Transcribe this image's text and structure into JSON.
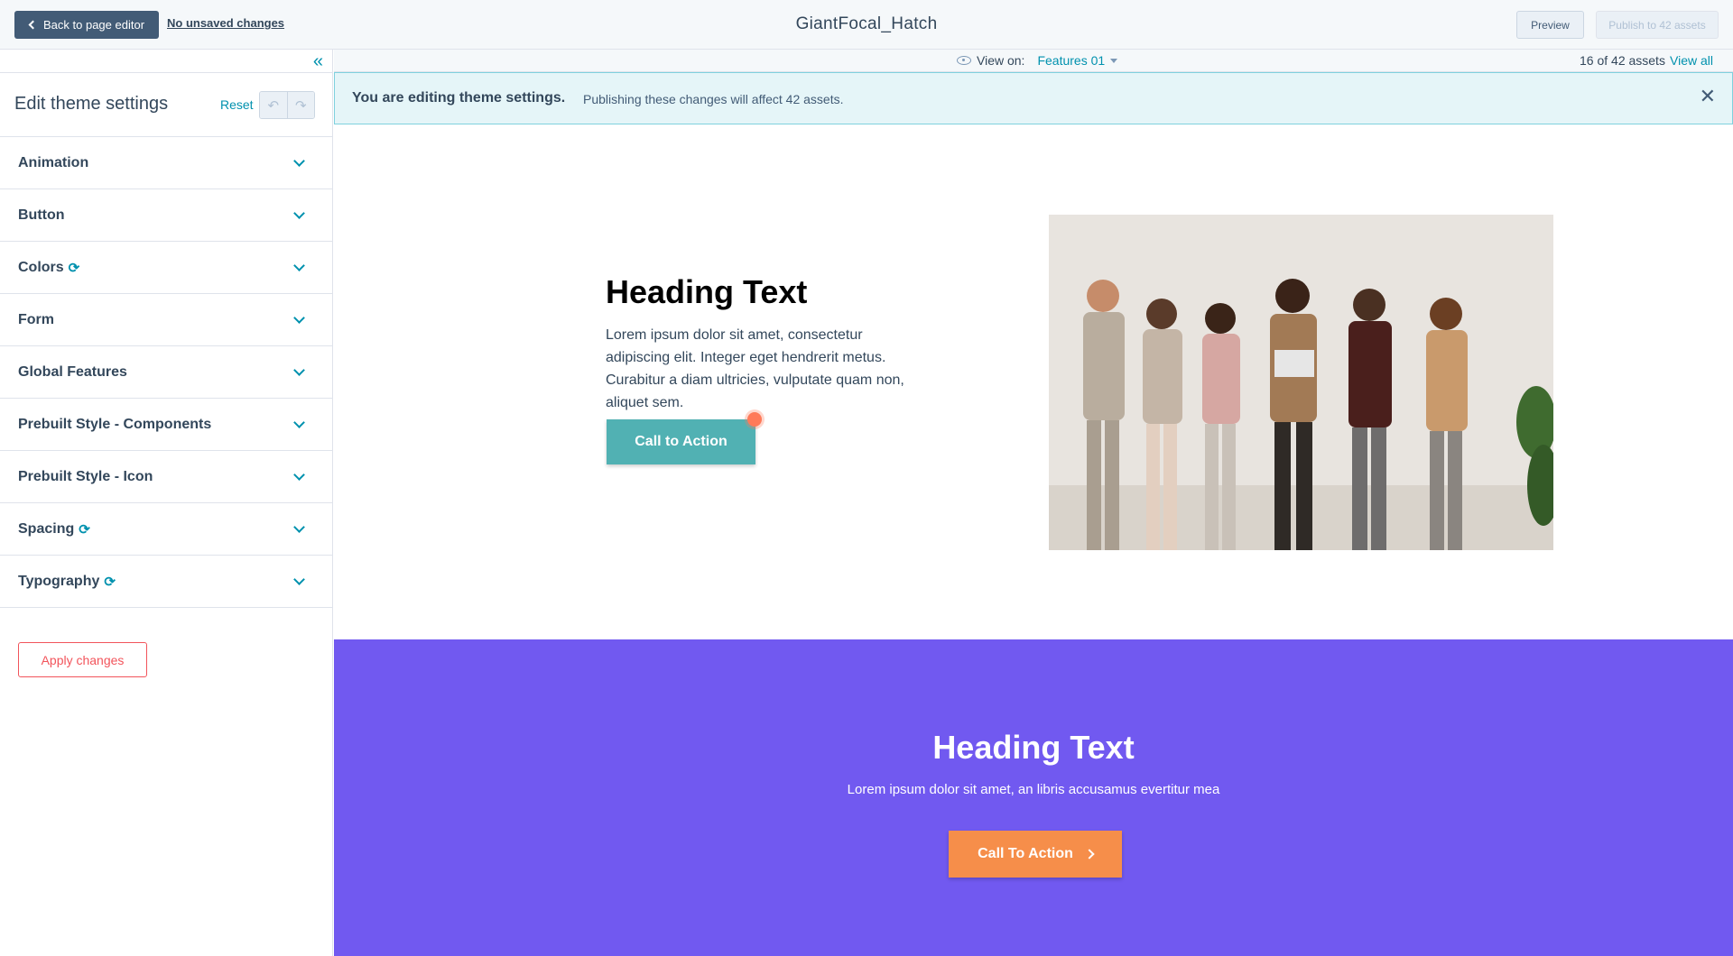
{
  "topbar": {
    "back_label": "Back to page editor",
    "unsaved_label": "No unsaved changes",
    "title": "GiantFocal_Hatch",
    "preview_label": "Preview",
    "publish_label": "Publish to 42 assets"
  },
  "sidebar": {
    "title": "Edit theme settings",
    "reset_label": "Reset",
    "items": [
      {
        "label": "Animation",
        "sync": false
      },
      {
        "label": "Button",
        "sync": false
      },
      {
        "label": "Colors",
        "sync": true
      },
      {
        "label": "Form",
        "sync": false
      },
      {
        "label": "Global Features",
        "sync": false
      },
      {
        "label": "Prebuilt Style - Components",
        "sync": false
      },
      {
        "label": "Prebuilt Style - Icon",
        "sync": false
      },
      {
        "label": "Spacing",
        "sync": true
      },
      {
        "label": "Typography",
        "sync": true
      }
    ],
    "apply_label": "Apply changes"
  },
  "viewbar": {
    "view_on_label": "View on:",
    "view_on_value": "Features 01",
    "asset_count": "16 of 42 assets",
    "view_all_label": "View all"
  },
  "banner": {
    "strong": "You are editing theme settings.",
    "text": "Publishing these changes will affect 42 assets."
  },
  "section1": {
    "heading": "Heading Text",
    "body": "Lorem ipsum dolor sit amet, consectetur adipiscing elit. Integer eget hendrerit metus. Curabitur a diam ultricies, vulputate quam non, aliquet sem.",
    "cta_label": "Call to Action"
  },
  "section2": {
    "heading": "Heading Text",
    "body": "Lorem ipsum dolor sit amet, an libris accusamus evertitur mea",
    "cta_label": "Call To Action"
  },
  "colors": {
    "accent": "#0091ae",
    "section2_bg": "#7159f0",
    "cta_teal": "#51b1b3",
    "cta_orange": "#f68e4a"
  }
}
